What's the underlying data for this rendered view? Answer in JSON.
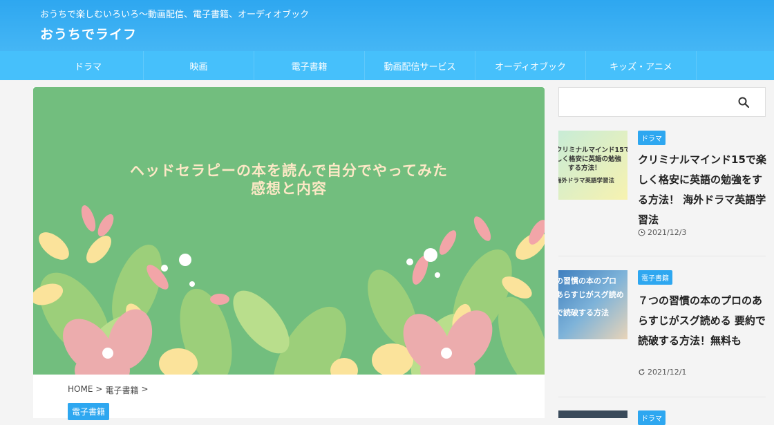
{
  "header": {
    "tagline": "おうちで楽しむいろいろ〜動画配信、電子書籍、オーディオブック",
    "site_title": "おうちでライフ"
  },
  "nav": {
    "items": [
      "ドラマ",
      "映画",
      "電子書籍",
      "動画配信サービス",
      "オーディオブック",
      "キッズ・アニメ"
    ]
  },
  "article": {
    "eyecatch_title_line1": "ヘッドセラピーの本を読んで自分でやってみた",
    "eyecatch_title_line2": "感想と内容",
    "breadcrumb": [
      "HOME",
      ">",
      "電子書籍",
      ">"
    ],
    "category": "電子書籍"
  },
  "search": {
    "placeholder": ""
  },
  "sidebar": {
    "items": [
      {
        "category": "ドラマ",
        "title": "クリミナルマインド15で楽しく格安に英語の勉強をする方法！ 海外ドラマ英語学習法",
        "date": "2021/12/3",
        "thumb_text1": "クリミナルマインド15で",
        "thumb_text2": "しく格安に英語の勉強",
        "thumb_text3": "する方法！",
        "thumb_text4": "海外ドラマ英語学習法"
      },
      {
        "category": "電子書籍",
        "title": "７つの習慣の本のプロのあらすじがスグ読める 要約で読破する方法！無料も",
        "date": "2021/12/1",
        "thumb_text1": "の習慣の本のプロ",
        "thumb_text2": "あらすじがスグ読め",
        "thumb_text3": "で読破する方法"
      },
      {
        "category": "ドラマ"
      }
    ]
  },
  "colors": {
    "accent": "#2ea7f0",
    "nav": "#46c0fb",
    "eyecatch_bg": "#72be7e"
  }
}
